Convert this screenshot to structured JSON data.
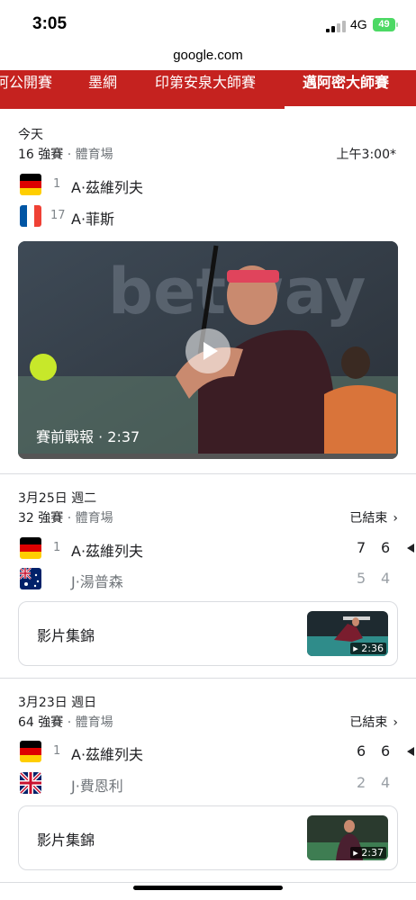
{
  "status": {
    "time": "3:05",
    "network": "4G",
    "battery": "49"
  },
  "browser": {
    "url": "google.com"
  },
  "tabs": [
    {
      "label": "迈阿密公開賽"
    },
    {
      "label": "墨網"
    },
    {
      "label": "印第安泉大師賽"
    },
    {
      "label": "邁阿密大師賽"
    }
  ],
  "tabs_visible": {
    "t0": "阿公開賽",
    "t1": "墨網",
    "t2": "印第安泉大師賽",
    "t3": "邁阿密大師賽"
  },
  "today": {
    "date": "今天",
    "round": "16 強賽",
    "venue": "體育場",
    "time": "上午3:00*",
    "p1": {
      "seed": "1",
      "name": "A·茲維列夫",
      "flag": "germany-flag"
    },
    "p2": {
      "seed": "17",
      "name": "A·菲斯",
      "flag": "france-flag"
    },
    "video_caption": "賽前戰報 · 2:37"
  },
  "match1": {
    "date": "3月25日 週二",
    "round": "32 強賽",
    "venue": "體育場",
    "status": "已結束",
    "p1": {
      "seed": "1",
      "name": "A·茲維列夫",
      "s1": "7",
      "s2": "6",
      "flag": "germany-flag"
    },
    "p2": {
      "seed": "",
      "name": "J·湯普森",
      "s1": "5",
      "s2": "4",
      "flag": "australia-flag"
    },
    "highlights": "影片集錦",
    "duration": "2:36"
  },
  "match2": {
    "date": "3月23日 週日",
    "round": "64 強賽",
    "venue": "體育場",
    "status": "已結束",
    "p1": {
      "seed": "1",
      "name": "A·茲維列夫",
      "s1": "6",
      "s2": "6",
      "flag": "germany-flag"
    },
    "p2": {
      "seed": "",
      "name": "J·費恩利",
      "s1": "2",
      "s2": "4",
      "flag": "uk-flag"
    },
    "highlights": "影片集錦",
    "duration": "2:37"
  },
  "colors": {
    "accent": "#c5221f",
    "text": "#202124",
    "muted": "#70757a"
  }
}
